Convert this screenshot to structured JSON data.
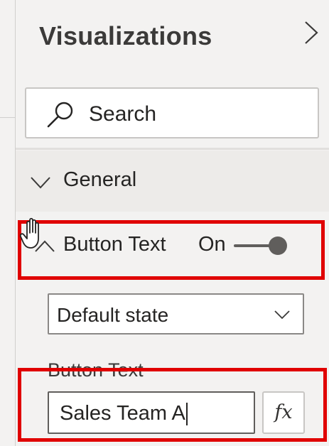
{
  "pane": {
    "title": "Visualizations",
    "collapse_icon": "chevron-right-icon"
  },
  "search": {
    "placeholder": "Search",
    "icon": "search-icon"
  },
  "sections": {
    "general": {
      "label": "General",
      "icon": "chevron-down-icon"
    },
    "button_text": {
      "label": "Button Text",
      "toggle_label": "On",
      "toggle_state": true,
      "icon": "chevron-up-icon"
    }
  },
  "state_dropdown": {
    "value": "Default state",
    "icon": "chevron-down-icon"
  },
  "button_text_field": {
    "label": "Button Text",
    "value": "Sales Team A",
    "fx_label": "fx"
  },
  "colors": {
    "highlight": "#e00000",
    "pane_background": "#f3f2f1",
    "section_background": "#edebe9"
  }
}
